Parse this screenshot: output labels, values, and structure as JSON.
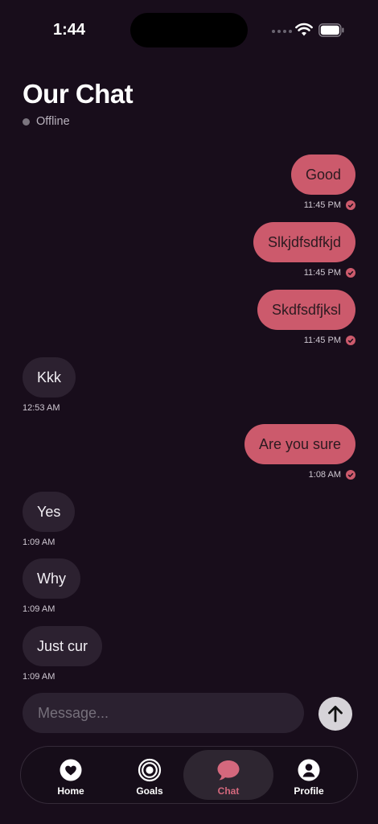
{
  "status_bar": {
    "time": "1:44"
  },
  "header": {
    "title": "Our Chat",
    "presence": "Offline"
  },
  "messages": [
    {
      "text": "Good",
      "time": "11:45 PM",
      "direction": "sent"
    },
    {
      "text": "Slkjdfsdfkjd",
      "time": "11:45 PM",
      "direction": "sent"
    },
    {
      "text": "Skdfsdfjksl",
      "time": "11:45 PM",
      "direction": "sent"
    },
    {
      "text": "Kkk",
      "time": "12:53 AM",
      "direction": "received"
    },
    {
      "text": "Are you sure",
      "time": "1:08 AM",
      "direction": "sent"
    },
    {
      "text": "Yes",
      "time": "1:09 AM",
      "direction": "received"
    },
    {
      "text": "Why",
      "time": "1:09 AM",
      "direction": "received"
    },
    {
      "text": "Just cur",
      "time": "1:09 AM",
      "direction": "received"
    }
  ],
  "composer": {
    "placeholder": "Message..."
  },
  "tabs": [
    {
      "label": "Home",
      "icon": "heart-icon"
    },
    {
      "label": "Goals",
      "icon": "target-icon"
    },
    {
      "label": "Chat",
      "icon": "chat-bubble-icon",
      "active": true
    },
    {
      "label": "Profile",
      "icon": "person-icon"
    }
  ],
  "colors": {
    "background": "#180d1b",
    "sent_bubble": "#cc5a6c",
    "received_bubble": "#2c2130",
    "accent": "#d4687d"
  }
}
